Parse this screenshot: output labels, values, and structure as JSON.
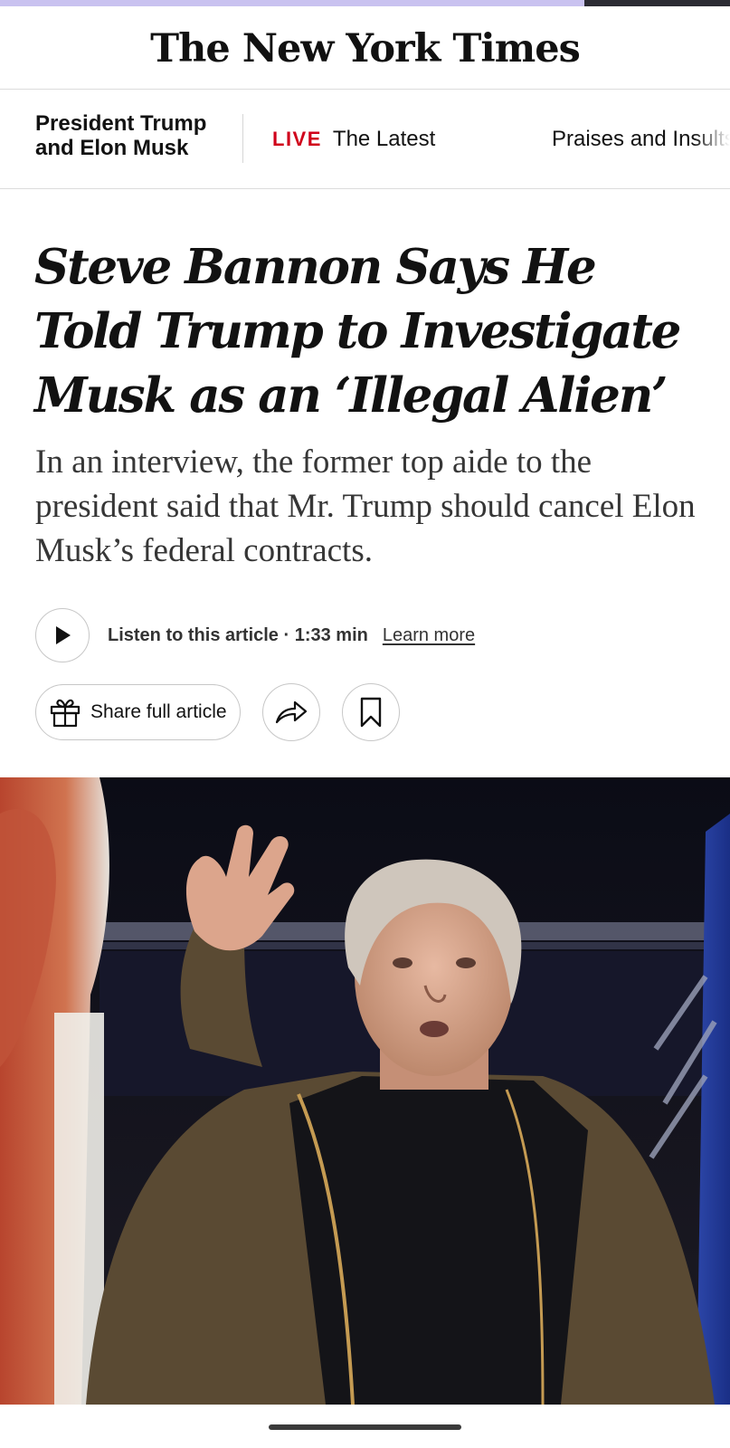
{
  "reading_progress_fraction": 0.8,
  "masthead": {
    "logo": "The New York Times"
  },
  "topic_bar": {
    "title": "President Trump and Elon Musk",
    "live_badge": "LIVE",
    "live_link": "The Latest",
    "next_link": "Praises and Insults"
  },
  "article": {
    "headline": "Steve Bannon Says He Told Trump to Investigate Musk as an ‘Illegal Alien’",
    "summary": "In an interview, the former top aide to the president said that Mr. Trump should cancel Elon Musk’s federal contracts.",
    "audio": {
      "listen_text": "Listen to this article · 1:33 min",
      "learn_more": "Learn more"
    },
    "share_full_article": "Share full article"
  },
  "icons": {
    "play": "play-icon",
    "gift": "gift-icon",
    "share": "share-arrow-icon",
    "bookmark": "bookmark-icon"
  },
  "colors": {
    "live_red": "#d0021b",
    "progress_fill": "#c9c2f0",
    "text": "#121212"
  }
}
